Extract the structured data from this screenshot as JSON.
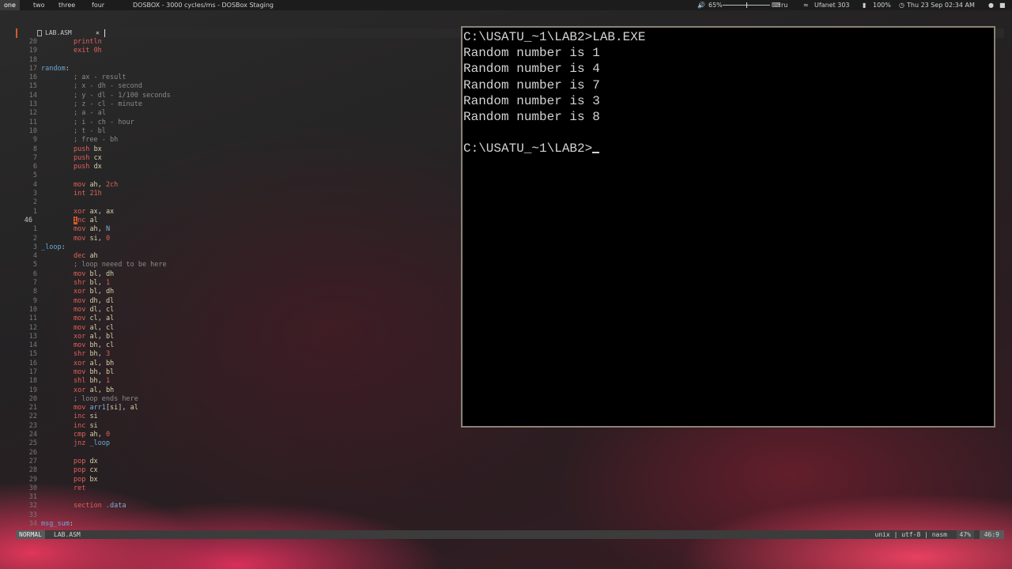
{
  "topbar": {
    "workspaces": [
      "one",
      "two",
      "three",
      "four"
    ],
    "window_title": "DOSBOX - 3000 cycles/ms - DOSBox Staging",
    "volume": "65%",
    "volume_level": 0.5,
    "keyboard_layout": "ru",
    "network": "Ufanet 303",
    "battery": "100%",
    "datetime": "Thu 23 Sep 02:34 AM"
  },
  "editor": {
    "tab_name": "LAB.ASM",
    "tab_close": "✕",
    "lines": [
      {
        "n": "20",
        "t": [
          [
            "",
            "        "
          ],
          [
            "kw",
            "println"
          ]
        ]
      },
      {
        "n": "19",
        "t": [
          [
            "",
            "        "
          ],
          [
            "kw",
            "exit"
          ],
          [
            "",
            " "
          ],
          [
            "num",
            "0h"
          ]
        ]
      },
      {
        "n": "18",
        "t": []
      },
      {
        "n": "17",
        "t": [
          [
            "lbl",
            "random"
          ],
          [
            "",
            ":"
          ]
        ]
      },
      {
        "n": "16",
        "t": [
          [
            "",
            "        "
          ],
          [
            "cm",
            "; ax - result"
          ]
        ]
      },
      {
        "n": "15",
        "t": [
          [
            "",
            "        "
          ],
          [
            "cm",
            "; x - dh - second"
          ]
        ]
      },
      {
        "n": "14",
        "t": [
          [
            "",
            "        "
          ],
          [
            "cm",
            "; y - dl - 1/100 seconds"
          ]
        ]
      },
      {
        "n": "13",
        "t": [
          [
            "",
            "        "
          ],
          [
            "cm",
            "; z - cl - minute"
          ]
        ]
      },
      {
        "n": "12",
        "t": [
          [
            "",
            "        "
          ],
          [
            "cm",
            "; a - al"
          ]
        ]
      },
      {
        "n": "11",
        "t": [
          [
            "",
            "        "
          ],
          [
            "cm",
            "; i - ch - hour"
          ]
        ]
      },
      {
        "n": "10",
        "t": [
          [
            "",
            "        "
          ],
          [
            "cm",
            "; t - bl"
          ]
        ]
      },
      {
        "n": "9",
        "t": [
          [
            "",
            "        "
          ],
          [
            "cm",
            "; free - bh"
          ]
        ]
      },
      {
        "n": "8",
        "t": [
          [
            "",
            "        "
          ],
          [
            "kw",
            "push"
          ],
          [
            "",
            " "
          ],
          [
            "reg",
            "bx"
          ]
        ]
      },
      {
        "n": "7",
        "t": [
          [
            "",
            "        "
          ],
          [
            "kw",
            "push"
          ],
          [
            "",
            " "
          ],
          [
            "reg",
            "cx"
          ]
        ]
      },
      {
        "n": "6",
        "t": [
          [
            "",
            "        "
          ],
          [
            "kw",
            "push"
          ],
          [
            "",
            " "
          ],
          [
            "reg",
            "dx"
          ]
        ]
      },
      {
        "n": "5",
        "t": []
      },
      {
        "n": "4",
        "t": [
          [
            "",
            "        "
          ],
          [
            "kw",
            "mov"
          ],
          [
            "",
            " "
          ],
          [
            "reg",
            "ah"
          ],
          [
            "",
            ", "
          ],
          [
            "num",
            "2ch"
          ]
        ]
      },
      {
        "n": "3",
        "t": [
          [
            "",
            "        "
          ],
          [
            "kw",
            "int"
          ],
          [
            "",
            " "
          ],
          [
            "num",
            "21h"
          ]
        ]
      },
      {
        "n": "2",
        "t": []
      },
      {
        "n": "1",
        "t": [
          [
            "",
            "        "
          ],
          [
            "kw",
            "xor"
          ],
          [
            "",
            " "
          ],
          [
            "reg",
            "ax"
          ],
          [
            "",
            ", "
          ],
          [
            "reg",
            "ax"
          ]
        ]
      },
      {
        "n": "46",
        "cur": true,
        "t": [
          [
            "",
            "        "
          ],
          [
            "curs",
            "i"
          ],
          [
            "kw",
            "nc"
          ],
          [
            "",
            " "
          ],
          [
            "reg",
            "al"
          ]
        ]
      },
      {
        "n": "1",
        "t": [
          [
            "",
            "        "
          ],
          [
            "kw",
            "mov"
          ],
          [
            "",
            " "
          ],
          [
            "reg",
            "ah"
          ],
          [
            "",
            ", "
          ],
          [
            "sym",
            "N"
          ]
        ]
      },
      {
        "n": "2",
        "t": [
          [
            "",
            "        "
          ],
          [
            "kw",
            "mov"
          ],
          [
            "",
            " "
          ],
          [
            "reg",
            "si"
          ],
          [
            "",
            ", "
          ],
          [
            "num",
            "0"
          ]
        ]
      },
      {
        "n": "3",
        "t": [
          [
            "lbl",
            "_loop"
          ],
          [
            "",
            ":"
          ]
        ]
      },
      {
        "n": "4",
        "t": [
          [
            "",
            "        "
          ],
          [
            "kw",
            "dec"
          ],
          [
            "",
            " "
          ],
          [
            "reg",
            "ah"
          ]
        ]
      },
      {
        "n": "5",
        "t": [
          [
            "",
            "        "
          ],
          [
            "cm",
            "; loop neeed to be here"
          ]
        ]
      },
      {
        "n": "6",
        "t": [
          [
            "",
            "        "
          ],
          [
            "kw",
            "mov"
          ],
          [
            "",
            " "
          ],
          [
            "reg",
            "bl"
          ],
          [
            "",
            ", "
          ],
          [
            "reg",
            "dh"
          ]
        ]
      },
      {
        "n": "7",
        "t": [
          [
            "",
            "        "
          ],
          [
            "kw",
            "shr"
          ],
          [
            "",
            " "
          ],
          [
            "reg",
            "bl"
          ],
          [
            "",
            ", "
          ],
          [
            "num",
            "1"
          ]
        ]
      },
      {
        "n": "8",
        "t": [
          [
            "",
            "        "
          ],
          [
            "kw",
            "xor"
          ],
          [
            "",
            " "
          ],
          [
            "reg",
            "bl"
          ],
          [
            "",
            ", "
          ],
          [
            "reg",
            "dh"
          ]
        ]
      },
      {
        "n": "9",
        "t": [
          [
            "",
            "        "
          ],
          [
            "kw",
            "mov"
          ],
          [
            "",
            " "
          ],
          [
            "reg",
            "dh"
          ],
          [
            "",
            ", "
          ],
          [
            "reg",
            "dl"
          ]
        ]
      },
      {
        "n": "10",
        "t": [
          [
            "",
            "        "
          ],
          [
            "kw",
            "mov"
          ],
          [
            "",
            " "
          ],
          [
            "reg",
            "dl"
          ],
          [
            "",
            ", "
          ],
          [
            "reg",
            "cl"
          ]
        ]
      },
      {
        "n": "11",
        "t": [
          [
            "",
            "        "
          ],
          [
            "kw",
            "mov"
          ],
          [
            "",
            " "
          ],
          [
            "reg",
            "cl"
          ],
          [
            "",
            ", "
          ],
          [
            "reg",
            "al"
          ]
        ]
      },
      {
        "n": "12",
        "t": [
          [
            "",
            "        "
          ],
          [
            "kw",
            "mov"
          ],
          [
            "",
            " "
          ],
          [
            "reg",
            "al"
          ],
          [
            "",
            ", "
          ],
          [
            "reg",
            "cl"
          ]
        ]
      },
      {
        "n": "13",
        "t": [
          [
            "",
            "        "
          ],
          [
            "kw",
            "xor"
          ],
          [
            "",
            " "
          ],
          [
            "reg",
            "al"
          ],
          [
            "",
            ", "
          ],
          [
            "reg",
            "bl"
          ]
        ]
      },
      {
        "n": "14",
        "t": [
          [
            "",
            "        "
          ],
          [
            "kw",
            "mov"
          ],
          [
            "",
            " "
          ],
          [
            "reg",
            "bh"
          ],
          [
            "",
            ", "
          ],
          [
            "reg",
            "cl"
          ]
        ]
      },
      {
        "n": "15",
        "t": [
          [
            "",
            "        "
          ],
          [
            "kw",
            "shr"
          ],
          [
            "",
            " "
          ],
          [
            "reg",
            "bh"
          ],
          [
            "",
            ", "
          ],
          [
            "num",
            "3"
          ]
        ]
      },
      {
        "n": "16",
        "t": [
          [
            "",
            "        "
          ],
          [
            "kw",
            "xor"
          ],
          [
            "",
            " "
          ],
          [
            "reg",
            "al"
          ],
          [
            "",
            ", "
          ],
          [
            "reg",
            "bh"
          ]
        ]
      },
      {
        "n": "17",
        "t": [
          [
            "",
            "        "
          ],
          [
            "kw",
            "mov"
          ],
          [
            "",
            " "
          ],
          [
            "reg",
            "bh"
          ],
          [
            "",
            ", "
          ],
          [
            "reg",
            "bl"
          ]
        ]
      },
      {
        "n": "18",
        "t": [
          [
            "",
            "        "
          ],
          [
            "kw",
            "shl"
          ],
          [
            "",
            " "
          ],
          [
            "reg",
            "bh"
          ],
          [
            "",
            ", "
          ],
          [
            "num",
            "1"
          ]
        ]
      },
      {
        "n": "19",
        "t": [
          [
            "",
            "        "
          ],
          [
            "kw",
            "xor"
          ],
          [
            "",
            " "
          ],
          [
            "reg",
            "al"
          ],
          [
            "",
            ", "
          ],
          [
            "reg",
            "bh"
          ]
        ]
      },
      {
        "n": "20",
        "t": [
          [
            "",
            "        "
          ],
          [
            "cm",
            "; loop ends here"
          ]
        ]
      },
      {
        "n": "21",
        "t": [
          [
            "",
            "        "
          ],
          [
            "kw",
            "mov"
          ],
          [
            "",
            " "
          ],
          [
            "sym",
            "arr1"
          ],
          [
            "",
            "["
          ],
          [
            "reg",
            "si"
          ],
          [
            "",
            "], "
          ],
          [
            "reg",
            "al"
          ]
        ]
      },
      {
        "n": "22",
        "t": [
          [
            "",
            "        "
          ],
          [
            "kw",
            "inc"
          ],
          [
            "",
            " "
          ],
          [
            "reg",
            "si"
          ]
        ]
      },
      {
        "n": "23",
        "t": [
          [
            "",
            "        "
          ],
          [
            "kw",
            "inc"
          ],
          [
            "",
            " "
          ],
          [
            "reg",
            "si"
          ]
        ]
      },
      {
        "n": "24",
        "t": [
          [
            "",
            "        "
          ],
          [
            "kw",
            "cmp"
          ],
          [
            "",
            " "
          ],
          [
            "reg",
            "ah"
          ],
          [
            "",
            ", "
          ],
          [
            "num",
            "0"
          ]
        ]
      },
      {
        "n": "25",
        "t": [
          [
            "",
            "        "
          ],
          [
            "kw",
            "jnz"
          ],
          [
            "",
            " "
          ],
          [
            "lbl",
            "_loop"
          ]
        ]
      },
      {
        "n": "26",
        "t": []
      },
      {
        "n": "27",
        "t": [
          [
            "",
            "        "
          ],
          [
            "kw",
            "pop"
          ],
          [
            "",
            " "
          ],
          [
            "reg",
            "dx"
          ]
        ]
      },
      {
        "n": "28",
        "t": [
          [
            "",
            "        "
          ],
          [
            "kw",
            "pop"
          ],
          [
            "",
            " "
          ],
          [
            "reg",
            "cx"
          ]
        ]
      },
      {
        "n": "29",
        "t": [
          [
            "",
            "        "
          ],
          [
            "kw",
            "pop"
          ],
          [
            "",
            " "
          ],
          [
            "reg",
            "bx"
          ]
        ]
      },
      {
        "n": "30",
        "t": [
          [
            "",
            "        "
          ],
          [
            "kw",
            "ret"
          ]
        ]
      },
      {
        "n": "31",
        "t": []
      },
      {
        "n": "32",
        "t": [
          [
            "",
            "        "
          ],
          [
            "kw",
            "section"
          ],
          [
            "",
            " "
          ],
          [
            "sym",
            ".data"
          ]
        ]
      },
      {
        "n": "33",
        "t": []
      },
      {
        "n": "34",
        "t": [
          [
            "lbl",
            "msg_sum"
          ],
          [
            "",
            ":"
          ]
        ]
      }
    ],
    "status": {
      "mode": "NORMAL",
      "file": "LAB.ASM",
      "info": "unix | utf-8 | nasm",
      "percent": "47%",
      "position": "46:9"
    }
  },
  "dosbox": {
    "lines": [
      "C:\\USATU_~1\\LAB2>LAB.EXE",
      "Random number is 1",
      "Random number is 4",
      "Random number is 7",
      "Random number is 3",
      "Random number is 8",
      ""
    ],
    "prompt": "C:\\USATU_~1\\LAB2>"
  }
}
